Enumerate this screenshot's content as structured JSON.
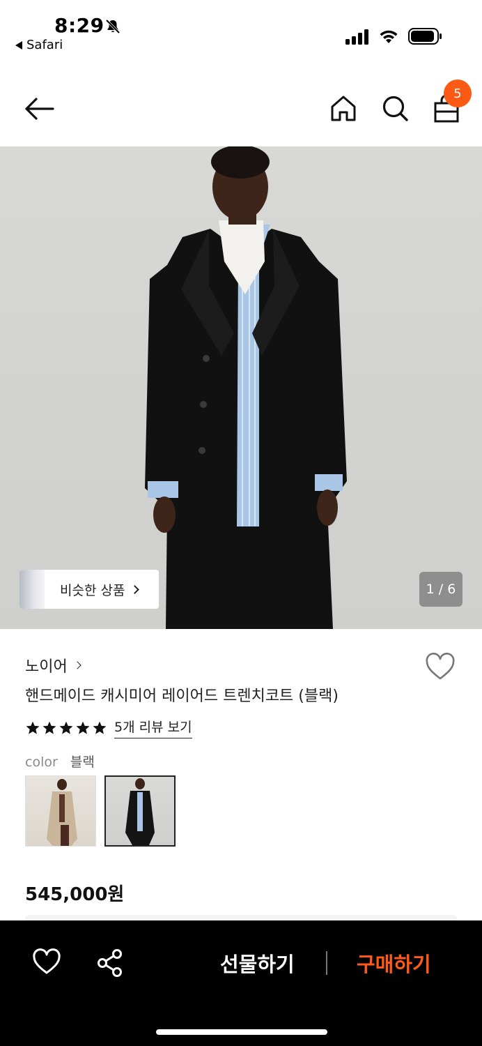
{
  "status_bar": {
    "time": "8:29",
    "back_app": "Safari"
  },
  "header": {
    "cart_count": "5",
    "icons": [
      "back-arrow-icon",
      "home-icon",
      "search-icon",
      "shopping-bag-icon"
    ]
  },
  "gallery": {
    "similar_label": "비슷한 상품",
    "counter": "1 / 6"
  },
  "product": {
    "brand": "노이어",
    "title": "핸드메이드 캐시미어 레이어드 트렌치코트 (블랙)",
    "rating_stars": 5,
    "review_link": "5개 리뷰 보기",
    "color_key": "color",
    "color_value": "블랙",
    "price": "545,000원"
  },
  "bottom_bar": {
    "gift_label": "선물하기",
    "buy_label": "구매하기"
  },
  "colors": {
    "accent": "#fa5a14",
    "buy_text": "#ff5a1a",
    "bottom_bg": "#000000"
  }
}
